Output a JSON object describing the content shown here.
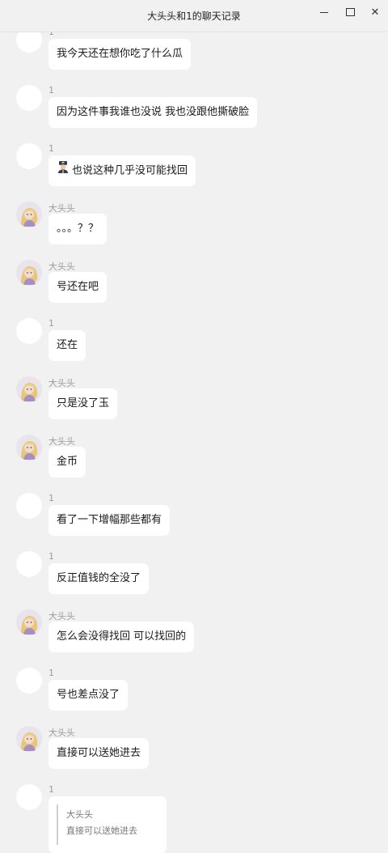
{
  "window": {
    "title": "大头头和1的聊天记录",
    "controls": {
      "minimize": "minimize-icon",
      "maximize": "maximize-icon",
      "close": "close-icon"
    }
  },
  "messages": [
    {
      "sender": "1",
      "text": "我今天还在想你吃了什么瓜",
      "avatar": "blank"
    },
    {
      "sender": "1",
      "text": "因为这件事我谁也没说 我也没跟他撕破脸",
      "avatar": "blank"
    },
    {
      "sender": "1",
      "text": "也说这种几乎没可能找回",
      "emoji": "police-officer-icon",
      "avatar": "blank"
    },
    {
      "sender": "大头头",
      "text": "。。。？？",
      "avatar": "anime-girl"
    },
    {
      "sender": "大头头",
      "text": "号还在吧",
      "avatar": "anime-girl"
    },
    {
      "sender": "1",
      "text": "还在",
      "avatar": "blank"
    },
    {
      "sender": "大头头",
      "text": "只是没了玉",
      "avatar": "anime-girl"
    },
    {
      "sender": "大头头",
      "text": "金币",
      "avatar": "anime-girl"
    },
    {
      "sender": "1",
      "text": "看了一下增幅那些都有",
      "avatar": "blank"
    },
    {
      "sender": "1",
      "text": "反正值钱的全没了",
      "avatar": "blank"
    },
    {
      "sender": "大头头",
      "text": "怎么会没得找回  可以找回的",
      "avatar": "anime-girl"
    },
    {
      "sender": "1",
      "text": "号也差点没了",
      "avatar": "blank"
    },
    {
      "sender": "大头头",
      "text": "直接可以送她进去",
      "avatar": "anime-girl"
    },
    {
      "sender": "1",
      "quote": {
        "name": "大头头",
        "text": "直接可以送她进去"
      },
      "avatar": "blank"
    }
  ]
}
